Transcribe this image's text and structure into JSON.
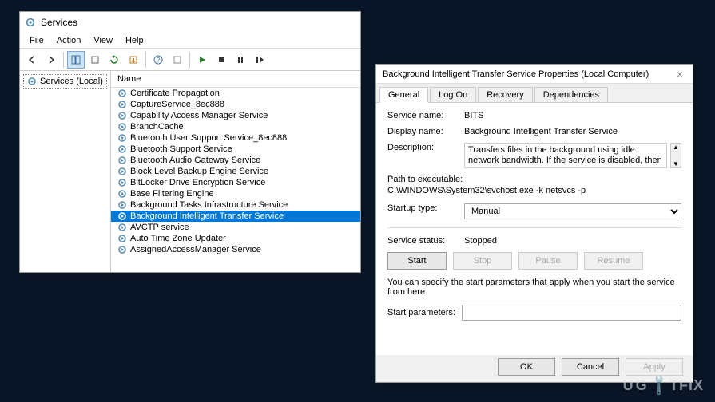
{
  "services_window": {
    "title": "Services",
    "menu": [
      "File",
      "Action",
      "View",
      "Help"
    ],
    "left_panel_node": "Services (Local)",
    "column_header": "Name",
    "items": [
      "Certificate Propagation",
      "CaptureService_8ec888",
      "Capability Access Manager Service",
      "BranchCache",
      "Bluetooth User Support Service_8ec888",
      "Bluetooth Support Service",
      "Bluetooth Audio Gateway Service",
      "Block Level Backup Engine Service",
      "BitLocker Drive Encryption Service",
      "Base Filtering Engine",
      "Background Tasks Infrastructure Service",
      "Background Intelligent Transfer Service",
      "AVCTP service",
      "Auto Time Zone Updater",
      "AssignedAccessManager Service"
    ],
    "selected_index": 11
  },
  "props": {
    "title": "Background Intelligent Transfer Service Properties (Local Computer)",
    "tabs": [
      "General",
      "Log On",
      "Recovery",
      "Dependencies"
    ],
    "active_tab": 0,
    "labels": {
      "service_name": "Service name:",
      "display_name": "Display name:",
      "description": "Description:",
      "path_to_exe": "Path to executable:",
      "startup_type": "Startup type:",
      "service_status": "Service status:",
      "specify_text": "You can specify the start parameters that apply when you start the service from here.",
      "start_parameters": "Start parameters:"
    },
    "values": {
      "service_name": "BITS",
      "display_name": "Background Intelligent Transfer Service",
      "description": "Transfers files in the background using idle network bandwidth. If the service is disabled, then any",
      "path": "C:\\WINDOWS\\System32\\svchost.exe -k netsvcs -p",
      "startup_type": "Manual",
      "status": "Stopped"
    },
    "buttons": {
      "start": "Start",
      "stop": "Stop",
      "pause": "Pause",
      "resume": "Resume",
      "ok": "OK",
      "cancel": "Cancel",
      "apply": "Apply"
    }
  },
  "watermark": "UGETFIX"
}
